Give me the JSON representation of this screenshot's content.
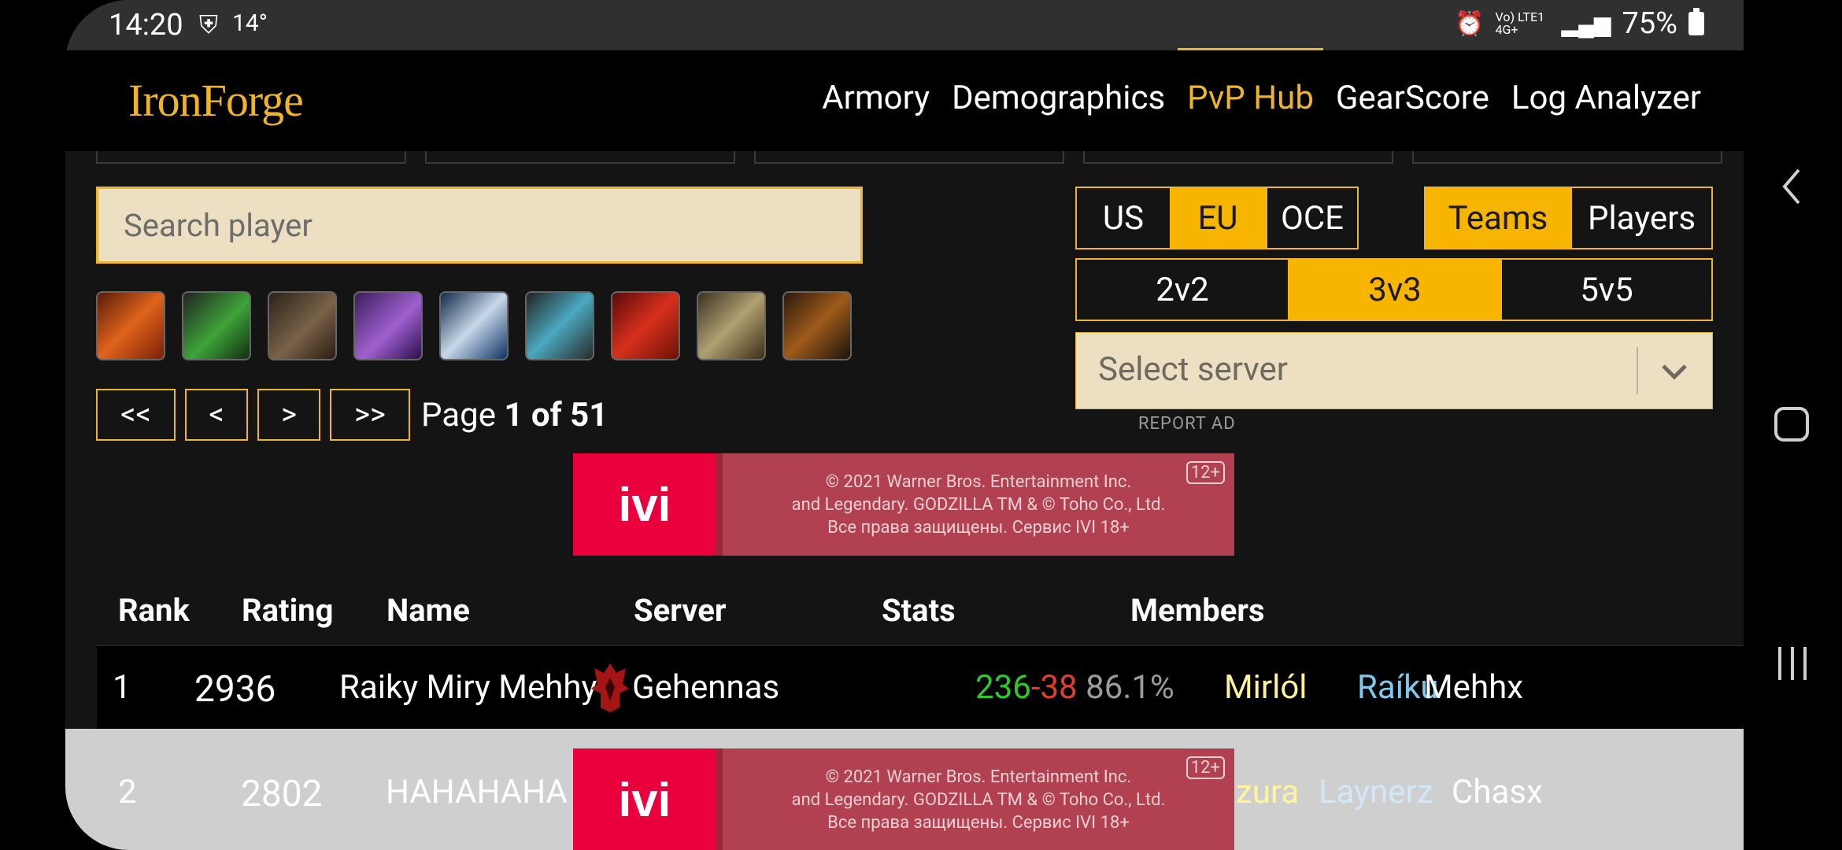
{
  "status": {
    "time": "14:20",
    "temp": "14°",
    "network": "Vo) LTE1 4G+",
    "battery": "75%"
  },
  "nav": {
    "logo": "IronForge",
    "links": [
      "Armory",
      "Demographics",
      "PvP Hub",
      "GearScore",
      "Log Analyzer"
    ],
    "active": "PvP Hub",
    "accent": "#f0b429"
  },
  "search": {
    "placeholder": "Search player"
  },
  "class_icons": [
    "warlock-class-icon",
    "druid-class-icon",
    "warrior-class-icon",
    "shadow-priest-class-icon",
    "rogue-class-icon",
    "shaman-class-icon",
    "death-knight-class-icon",
    "paladin-class-icon",
    "hunter-class-icon"
  ],
  "pager": {
    "first": "<<",
    "prev": "<",
    "next": ">",
    "last": ">>",
    "label": "Page ",
    "value": "1 of 51"
  },
  "region": {
    "options": [
      "US",
      "EU",
      "OCE"
    ],
    "selected": "EU"
  },
  "mode": {
    "options": [
      "Teams",
      "Players"
    ],
    "selected": "Teams"
  },
  "bracket": {
    "options": [
      "2v2",
      "3v3",
      "5v5"
    ],
    "selected": "3v3"
  },
  "server_select": {
    "placeholder": "Select server"
  },
  "report_ad": "REPORT AD",
  "ad": {
    "logo": "ivi",
    "lines": [
      "© 2021 Warner Bros. Entertainment Inc.",
      "and Legendary. GODZILLA TM & © Toho Co., Ltd.",
      "Все права защищены. Сервис IVI 18+"
    ],
    "age": "12+"
  },
  "table": {
    "headers": [
      "Rank",
      "Rating",
      "Name",
      "Server",
      "Stats",
      "Members"
    ],
    "rows": [
      {
        "rank": "1",
        "rating": "2936",
        "name": "Raiky Miry Mehhy",
        "server": "Gehennas",
        "wins": "236",
        "dash": "-",
        "losses": "38",
        "pct": "86.1%",
        "members": [
          "Mirlól",
          "Raíku",
          "Mehhx"
        ]
      },
      {
        "rank": "2",
        "rating": "2802",
        "name": "HAHAHAHA",
        "members": [
          "zura",
          "Laynerz",
          "Chasx"
        ]
      }
    ]
  },
  "colors": {
    "win": "#2ccb2c",
    "loss": "#e0402a",
    "pct": "#9b9b9b",
    "m1": "#fff49b",
    "m2": "#7fc8ea",
    "m3": "#ffffff"
  }
}
